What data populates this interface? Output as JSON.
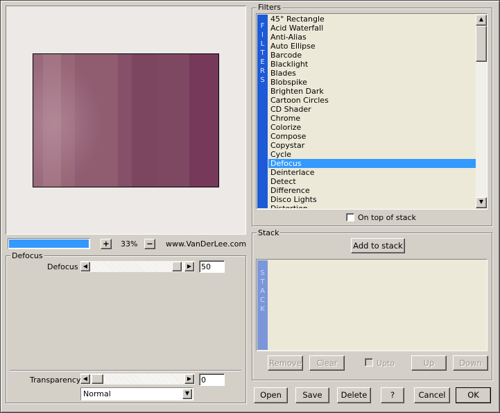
{
  "preview": {
    "zoom": "33%",
    "plus_label": "+",
    "minus_label": "−",
    "website": "www.VanDerLee.com"
  },
  "filters_panel": {
    "title": "Filters",
    "vertical_label": "FILTERS",
    "items": [
      "45° Rectangle",
      "Acid Waterfall",
      "Anti-Alias",
      "Auto Ellipse",
      "Barcode",
      "Blacklight",
      "Blades",
      "Blobspike",
      "Brighten Dark",
      "Cartoon Circles",
      "CD Shader",
      "Chrome",
      "Colorize",
      "Compose",
      "Copystar",
      "Cycle",
      "Defocus",
      "Deinterlace",
      "Detect",
      "Difference",
      "Disco Lights",
      "Distortion"
    ],
    "selected": "Defocus",
    "on_top_label": "On top of stack",
    "on_top_checked": false
  },
  "defocus_panel": {
    "title": "Defocus",
    "param_label": "Defocus",
    "param_value": "50",
    "transparency_label": "Transparency",
    "transparency_value": "0",
    "blend_mode": "Normal"
  },
  "stack_panel": {
    "title": "Stack",
    "vertical_label": "STACK",
    "add_label": "Add to stack",
    "remove_label": "Remove",
    "clear_label": "Clear",
    "upto_label": "Upto",
    "up_label": "Up",
    "down_label": "Down"
  },
  "footer": {
    "open": "Open",
    "save": "Save",
    "delete": "Delete",
    "help": "?",
    "cancel": "Cancel",
    "ok": "OK"
  },
  "colors": {
    "selection": "#3399ff",
    "filter_bar": "#1c5ad8",
    "stack_bar": "#7b96d9",
    "list_bg": "#ece9d8",
    "preview_mauve": "#7a3e58"
  },
  "icons": [
    "scroll-up-arrow-icon",
    "scroll-down-arrow-icon",
    "slider-left-arrow-icon",
    "slider-right-arrow-icon",
    "dropdown-arrow-icon"
  ]
}
